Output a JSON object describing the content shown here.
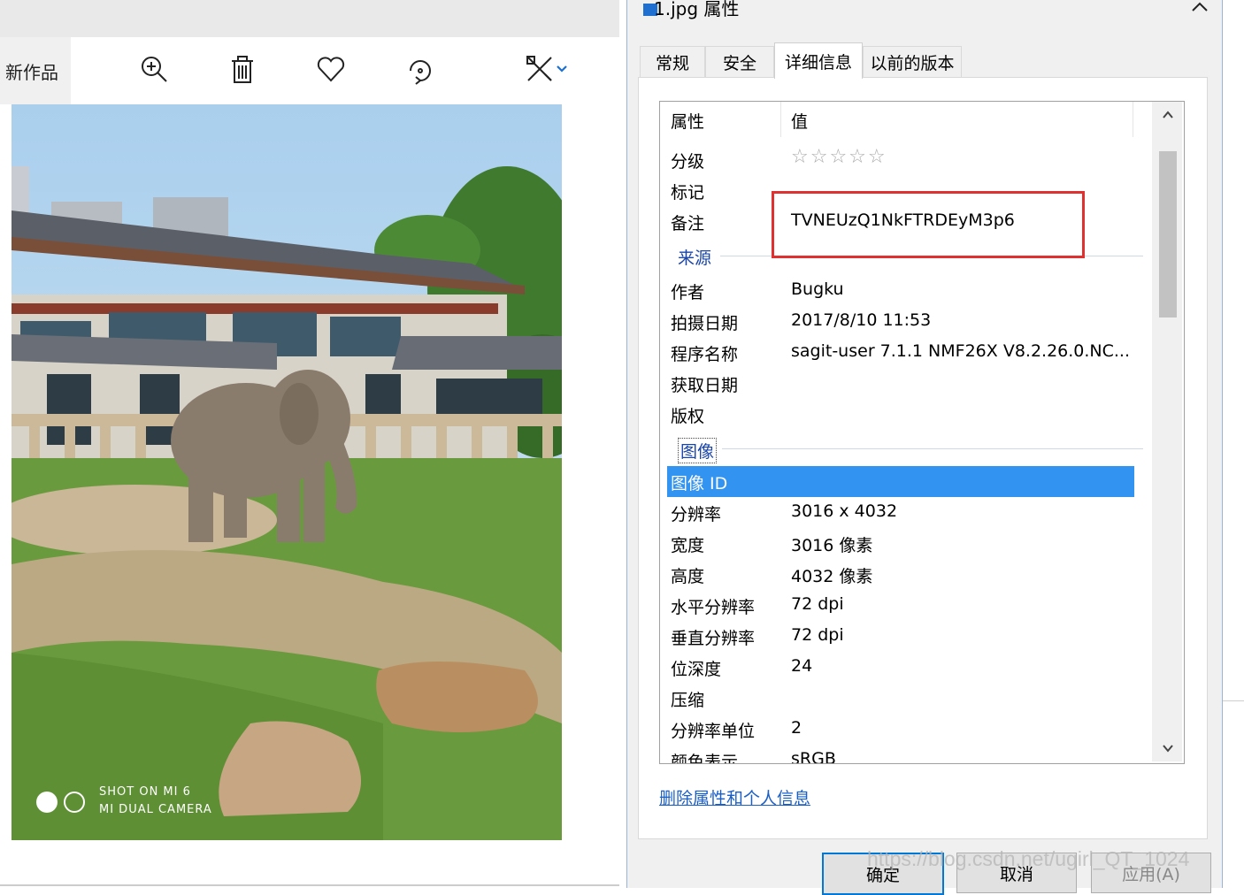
{
  "viewer": {
    "title": "新作品",
    "watermark_line1": "SHOT ON MI 6",
    "watermark_line2": "MI DUAL CAMERA"
  },
  "dialog": {
    "title": "1.jpg 属性",
    "tabs": [
      {
        "label": "常规",
        "active": false
      },
      {
        "label": "安全",
        "active": false
      },
      {
        "label": "详细信息",
        "active": true
      },
      {
        "label": "以前的版本",
        "active": false
      }
    ],
    "list": {
      "col_property": "属性",
      "col_value": "值",
      "rating_label": "分级",
      "rating_stars": "☆☆☆☆☆",
      "tags_label": "标记",
      "comments_label": "备注",
      "comments_value": "TVNEUzQ1NkFTRDEyM3p6",
      "origin_group": "来源",
      "origin": [
        {
          "k": "作者",
          "v": "Bugku"
        },
        {
          "k": "拍摄日期",
          "v": "2017/8/10 11:53"
        },
        {
          "k": "程序名称",
          "v": "sagit-user 7.1.1 NMF26X V8.2.26.0.NC..."
        },
        {
          "k": "获取日期",
          "v": ""
        },
        {
          "k": "版权",
          "v": ""
        }
      ],
      "image_group": "图像",
      "image_id_label": "图像 ID",
      "image": [
        {
          "k": "分辨率",
          "v": "3016 x 4032"
        },
        {
          "k": "宽度",
          "v": "3016 像素"
        },
        {
          "k": "高度",
          "v": "4032 像素"
        },
        {
          "k": "水平分辨率",
          "v": "72 dpi"
        },
        {
          "k": "垂直分辨率",
          "v": "72 dpi"
        },
        {
          "k": "位深度",
          "v": "24"
        },
        {
          "k": "压缩",
          "v": ""
        },
        {
          "k": "分辨率单位",
          "v": "2"
        },
        {
          "k": "颜色表示",
          "v": "sRGB"
        }
      ]
    },
    "remove_link": "删除属性和个人信息",
    "ok_label": "确定",
    "cancel_label": "取消",
    "apply_label": "应用(A)"
  },
  "overlay_watermark": "https://blog.csdn.net/ugirl_QT_1024",
  "colors": {
    "highlight_border": "#e03131",
    "selected_row": "#3393f0",
    "link": "#1a5fc8"
  }
}
